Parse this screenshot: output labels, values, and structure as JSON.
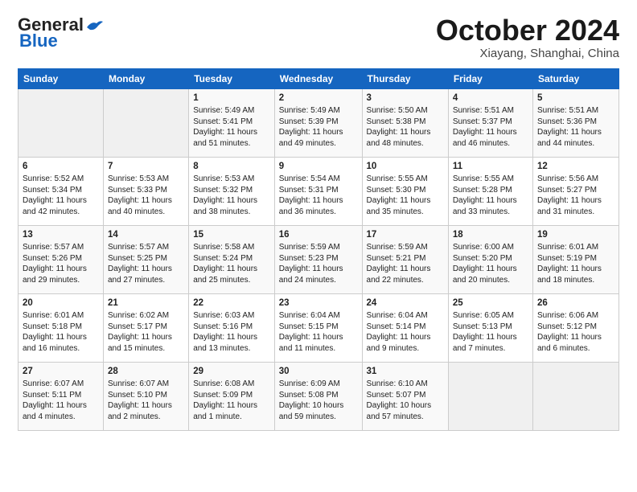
{
  "header": {
    "logo_general": "General",
    "logo_blue": "Blue",
    "month_title": "October 2024",
    "location": "Xiayang, Shanghai, China"
  },
  "days_of_week": [
    "Sunday",
    "Monday",
    "Tuesday",
    "Wednesday",
    "Thursday",
    "Friday",
    "Saturday"
  ],
  "weeks": [
    [
      {
        "day": "",
        "info": ""
      },
      {
        "day": "",
        "info": ""
      },
      {
        "day": "1",
        "info": "Sunrise: 5:49 AM\nSunset: 5:41 PM\nDaylight: 11 hours and 51 minutes."
      },
      {
        "day": "2",
        "info": "Sunrise: 5:49 AM\nSunset: 5:39 PM\nDaylight: 11 hours and 49 minutes."
      },
      {
        "day": "3",
        "info": "Sunrise: 5:50 AM\nSunset: 5:38 PM\nDaylight: 11 hours and 48 minutes."
      },
      {
        "day": "4",
        "info": "Sunrise: 5:51 AM\nSunset: 5:37 PM\nDaylight: 11 hours and 46 minutes."
      },
      {
        "day": "5",
        "info": "Sunrise: 5:51 AM\nSunset: 5:36 PM\nDaylight: 11 hours and 44 minutes."
      }
    ],
    [
      {
        "day": "6",
        "info": "Sunrise: 5:52 AM\nSunset: 5:34 PM\nDaylight: 11 hours and 42 minutes."
      },
      {
        "day": "7",
        "info": "Sunrise: 5:53 AM\nSunset: 5:33 PM\nDaylight: 11 hours and 40 minutes."
      },
      {
        "day": "8",
        "info": "Sunrise: 5:53 AM\nSunset: 5:32 PM\nDaylight: 11 hours and 38 minutes."
      },
      {
        "day": "9",
        "info": "Sunrise: 5:54 AM\nSunset: 5:31 PM\nDaylight: 11 hours and 36 minutes."
      },
      {
        "day": "10",
        "info": "Sunrise: 5:55 AM\nSunset: 5:30 PM\nDaylight: 11 hours and 35 minutes."
      },
      {
        "day": "11",
        "info": "Sunrise: 5:55 AM\nSunset: 5:28 PM\nDaylight: 11 hours and 33 minutes."
      },
      {
        "day": "12",
        "info": "Sunrise: 5:56 AM\nSunset: 5:27 PM\nDaylight: 11 hours and 31 minutes."
      }
    ],
    [
      {
        "day": "13",
        "info": "Sunrise: 5:57 AM\nSunset: 5:26 PM\nDaylight: 11 hours and 29 minutes."
      },
      {
        "day": "14",
        "info": "Sunrise: 5:57 AM\nSunset: 5:25 PM\nDaylight: 11 hours and 27 minutes."
      },
      {
        "day": "15",
        "info": "Sunrise: 5:58 AM\nSunset: 5:24 PM\nDaylight: 11 hours and 25 minutes."
      },
      {
        "day": "16",
        "info": "Sunrise: 5:59 AM\nSunset: 5:23 PM\nDaylight: 11 hours and 24 minutes."
      },
      {
        "day": "17",
        "info": "Sunrise: 5:59 AM\nSunset: 5:21 PM\nDaylight: 11 hours and 22 minutes."
      },
      {
        "day": "18",
        "info": "Sunrise: 6:00 AM\nSunset: 5:20 PM\nDaylight: 11 hours and 20 minutes."
      },
      {
        "day": "19",
        "info": "Sunrise: 6:01 AM\nSunset: 5:19 PM\nDaylight: 11 hours and 18 minutes."
      }
    ],
    [
      {
        "day": "20",
        "info": "Sunrise: 6:01 AM\nSunset: 5:18 PM\nDaylight: 11 hours and 16 minutes."
      },
      {
        "day": "21",
        "info": "Sunrise: 6:02 AM\nSunset: 5:17 PM\nDaylight: 11 hours and 15 minutes."
      },
      {
        "day": "22",
        "info": "Sunrise: 6:03 AM\nSunset: 5:16 PM\nDaylight: 11 hours and 13 minutes."
      },
      {
        "day": "23",
        "info": "Sunrise: 6:04 AM\nSunset: 5:15 PM\nDaylight: 11 hours and 11 minutes."
      },
      {
        "day": "24",
        "info": "Sunrise: 6:04 AM\nSunset: 5:14 PM\nDaylight: 11 hours and 9 minutes."
      },
      {
        "day": "25",
        "info": "Sunrise: 6:05 AM\nSunset: 5:13 PM\nDaylight: 11 hours and 7 minutes."
      },
      {
        "day": "26",
        "info": "Sunrise: 6:06 AM\nSunset: 5:12 PM\nDaylight: 11 hours and 6 minutes."
      }
    ],
    [
      {
        "day": "27",
        "info": "Sunrise: 6:07 AM\nSunset: 5:11 PM\nDaylight: 11 hours and 4 minutes."
      },
      {
        "day": "28",
        "info": "Sunrise: 6:07 AM\nSunset: 5:10 PM\nDaylight: 11 hours and 2 minutes."
      },
      {
        "day": "29",
        "info": "Sunrise: 6:08 AM\nSunset: 5:09 PM\nDaylight: 11 hours and 1 minute."
      },
      {
        "day": "30",
        "info": "Sunrise: 6:09 AM\nSunset: 5:08 PM\nDaylight: 10 hours and 59 minutes."
      },
      {
        "day": "31",
        "info": "Sunrise: 6:10 AM\nSunset: 5:07 PM\nDaylight: 10 hours and 57 minutes."
      },
      {
        "day": "",
        "info": ""
      },
      {
        "day": "",
        "info": ""
      }
    ]
  ]
}
